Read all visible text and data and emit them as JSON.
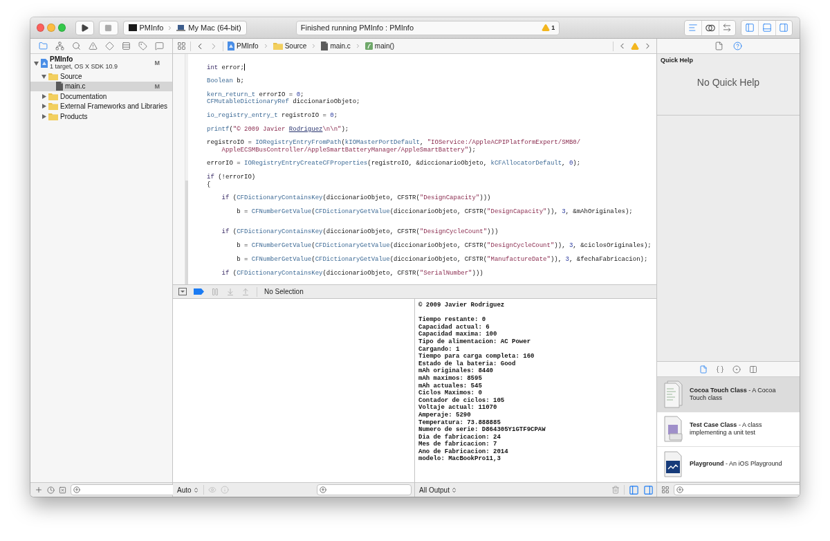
{
  "toolbar": {
    "scheme": {
      "target": "PMInfo",
      "destination": "My Mac (64-bit)"
    },
    "activity": {
      "status": "Finished running PMInfo : PMInfo",
      "warning_count": "1"
    },
    "editor_modes": [
      {
        "selected": true
      },
      {
        "selected": false
      },
      {
        "selected": false
      }
    ],
    "panel_toggles": [
      {
        "on": true
      },
      {
        "on": true
      },
      {
        "on": true
      }
    ]
  },
  "navigator": {
    "tabs": [
      {
        "selected": true
      },
      {
        "selected": false
      },
      {
        "selected": false
      },
      {
        "selected": false
      },
      {
        "selected": false
      },
      {
        "selected": false
      },
      {
        "selected": false
      },
      {
        "selected": false
      }
    ],
    "tree": [
      {
        "name": "PMInfo",
        "subtitle": "1 target, OS X SDK 10.9",
        "badge": "M",
        "kind": "project",
        "expanded": true,
        "selected": false,
        "children": [
          {
            "name": "Source",
            "kind": "folder",
            "expanded": true,
            "selected": false,
            "children": [
              {
                "name": "main.c",
                "kind": "file",
                "badge": "M",
                "selected": true
              }
            ]
          },
          {
            "name": "Documentation",
            "kind": "folder",
            "expanded": false,
            "selected": false
          },
          {
            "name": "External Frameworks and Libraries",
            "kind": "folder",
            "expanded": false,
            "selected": false
          },
          {
            "name": "Products",
            "kind": "folder",
            "expanded": false,
            "selected": false
          }
        ]
      }
    ]
  },
  "jump_bar": {
    "path": [
      {
        "label": "PMInfo",
        "kind": "project"
      },
      {
        "label": "Source",
        "kind": "folder"
      },
      {
        "label": "main.c",
        "kind": "file"
      },
      {
        "label": "main()",
        "kind": "function"
      }
    ]
  },
  "editor": {
    "lines": [
      {
        "kind": "code",
        "caret": true,
        "tokens": [
          {
            "text": "int",
            "kind": "keyword"
          },
          {
            "text": " error;",
            "kind": "plain"
          }
        ]
      },
      {
        "kind": "blank"
      },
      {
        "kind": "code",
        "tokens": [
          {
            "text": "Boolean",
            "kind": "symbol"
          },
          {
            "text": " b;",
            "kind": "plain"
          }
        ]
      },
      {
        "kind": "blank"
      },
      {
        "kind": "code",
        "tokens": [
          {
            "text": "kern_return_t",
            "kind": "symbol"
          },
          {
            "text": " errorIO = ",
            "kind": "plain"
          },
          {
            "text": "0",
            "kind": "number"
          },
          {
            "text": ";",
            "kind": "plain"
          }
        ]
      },
      {
        "kind": "code",
        "tokens": [
          {
            "text": "CFMutableDictionaryRef",
            "kind": "symbol"
          },
          {
            "text": " diccionarioObjeto;",
            "kind": "plain"
          }
        ]
      },
      {
        "kind": "blank"
      },
      {
        "kind": "code",
        "tokens": [
          {
            "text": "io_registry_entry_t",
            "kind": "symbol"
          },
          {
            "text": " registroIO = ",
            "kind": "plain"
          },
          {
            "text": "0",
            "kind": "number"
          },
          {
            "text": ";",
            "kind": "plain"
          }
        ]
      },
      {
        "kind": "blank"
      },
      {
        "kind": "code",
        "tokens": [
          {
            "text": "printf",
            "kind": "symbol"
          },
          {
            "text": "(",
            "kind": "plain"
          },
          {
            "text": "\"© 2009 Javier ",
            "kind": "string"
          },
          {
            "text": "Rodriguez",
            "kind": "link"
          },
          {
            "text": "\\n\\n\"",
            "kind": "string"
          },
          {
            "text": ");",
            "kind": "plain"
          }
        ]
      },
      {
        "kind": "blank"
      },
      {
        "kind": "code",
        "tokens": [
          {
            "text": "registroIO = ",
            "kind": "plain"
          },
          {
            "text": "IORegistryEntryFromPath",
            "kind": "symbol"
          },
          {
            "text": "(",
            "kind": "plain"
          },
          {
            "text": "kIOMasterPortDefault",
            "kind": "symbol"
          },
          {
            "text": ", ",
            "kind": "plain"
          },
          {
            "text": "\"IOService:/AppleACPIPlatformExpert/SMB0/",
            "kind": "string"
          }
        ]
      },
      {
        "kind": "code",
        "tokens": [
          {
            "text": "    AppleECSMBusController/AppleSmartBatteryManager/AppleSmartBattery\"",
            "kind": "string"
          },
          {
            "text": ");",
            "kind": "plain"
          }
        ]
      },
      {
        "kind": "blank"
      },
      {
        "kind": "code",
        "tokens": [
          {
            "text": "errorIO = ",
            "kind": "plain"
          },
          {
            "text": "IORegistryEntryCreateCFProperties",
            "kind": "symbol"
          },
          {
            "text": "(registroIO, &diccionarioObjeto, ",
            "kind": "plain"
          },
          {
            "text": "kCFAllocatorDefault",
            "kind": "symbol"
          },
          {
            "text": ", ",
            "kind": "plain"
          },
          {
            "text": "0",
            "kind": "number"
          },
          {
            "text": ");",
            "kind": "plain"
          }
        ]
      },
      {
        "kind": "blank"
      },
      {
        "kind": "code",
        "tokens": [
          {
            "text": "if",
            "kind": "keyword"
          },
          {
            "text": " (!errorIO)",
            "kind": "plain"
          }
        ]
      },
      {
        "kind": "code",
        "tokens": [
          {
            "text": "{",
            "kind": "plain"
          }
        ]
      },
      {
        "kind": "blank"
      },
      {
        "kind": "code",
        "tokens": [
          {
            "text": "    if",
            "kind": "keyword"
          },
          {
            "text": " (",
            "kind": "plain"
          },
          {
            "text": "CFDictionaryContainsKey",
            "kind": "symbol"
          },
          {
            "text": "(diccionarioObjeto, CFSTR(",
            "kind": "plain"
          },
          {
            "text": "\"DesignCapacity\"",
            "kind": "string"
          },
          {
            "text": ")))",
            "kind": "plain"
          }
        ]
      },
      {
        "kind": "blank"
      },
      {
        "kind": "code",
        "tokens": [
          {
            "text": "        b = ",
            "kind": "plain"
          },
          {
            "text": "CFNumberGetValue",
            "kind": "symbol"
          },
          {
            "text": "(",
            "kind": "plain"
          },
          {
            "text": "CFDictionaryGetValue",
            "kind": "symbol"
          },
          {
            "text": "(diccionarioObjeto, CFSTR(",
            "kind": "plain"
          },
          {
            "text": "\"DesignCapacity\"",
            "kind": "string"
          },
          {
            "text": ")), ",
            "kind": "plain"
          },
          {
            "text": "3",
            "kind": "number"
          },
          {
            "text": ", &mAhOriginales);",
            "kind": "plain"
          }
        ]
      },
      {
        "kind": "blank"
      },
      {
        "kind": "blank"
      },
      {
        "kind": "code",
        "tokens": [
          {
            "text": "    if",
            "kind": "keyword"
          },
          {
            "text": " (",
            "kind": "plain"
          },
          {
            "text": "CFDictionaryContainsKey",
            "kind": "symbol"
          },
          {
            "text": "(diccionarioObjeto, CFSTR(",
            "kind": "plain"
          },
          {
            "text": "\"DesignCycleCount\"",
            "kind": "string"
          },
          {
            "text": ")))",
            "kind": "plain"
          }
        ]
      },
      {
        "kind": "blank"
      },
      {
        "kind": "code",
        "tokens": [
          {
            "text": "        b = ",
            "kind": "plain"
          },
          {
            "text": "CFNumberGetValue",
            "kind": "symbol"
          },
          {
            "text": "(",
            "kind": "plain"
          },
          {
            "text": "CFDictionaryGetValue",
            "kind": "symbol"
          },
          {
            "text": "(diccionarioObjeto, CFSTR(",
            "kind": "plain"
          },
          {
            "text": "\"DesignCycleCount\"",
            "kind": "string"
          },
          {
            "text": ")), ",
            "kind": "plain"
          },
          {
            "text": "3",
            "kind": "number"
          },
          {
            "text": ", &ciclosOriginales);",
            "kind": "plain"
          }
        ]
      },
      {
        "kind": "blank"
      },
      {
        "kind": "code",
        "tokens": [
          {
            "text": "        b = ",
            "kind": "plain"
          },
          {
            "text": "CFNumberGetValue",
            "kind": "symbol"
          },
          {
            "text": "(",
            "kind": "plain"
          },
          {
            "text": "CFDictionaryGetValue",
            "kind": "symbol"
          },
          {
            "text": "(diccionarioObjeto, CFSTR(",
            "kind": "plain"
          },
          {
            "text": "\"ManufactureDate\"",
            "kind": "string"
          },
          {
            "text": ")), ",
            "kind": "plain"
          },
          {
            "text": "3",
            "kind": "number"
          },
          {
            "text": ", &fechaFabricacion);",
            "kind": "plain"
          }
        ]
      },
      {
        "kind": "blank"
      },
      {
        "kind": "code",
        "tokens": [
          {
            "text": "    if",
            "kind": "keyword"
          },
          {
            "text": " (",
            "kind": "plain"
          },
          {
            "text": "CFDictionaryContainsKey",
            "kind": "symbol"
          },
          {
            "text": "(diccionarioObjeto, CFSTR(",
            "kind": "plain"
          },
          {
            "text": "\"SerialNumber\"",
            "kind": "string"
          },
          {
            "text": ")))",
            "kind": "plain"
          }
        ]
      }
    ]
  },
  "debug_bar": {
    "breakpoints_active": true,
    "status": "No Selection"
  },
  "variables_view": {
    "scope": "Auto"
  },
  "console": {
    "output": "© 2009 Javier Rodriguez\n\nTiempo restante: 0\nCapacidad actual: 6\nCapacidad maxima: 100\nTipo de alimentacion: AC Power\nCargando: 1\nTiempo para carga completa: 160\nEstado de la bateria: Good\nmAh originales: 8440\nmAh maximos: 8595\nmAh actuales: 545\nCiclos Maximos: 0\nContador de ciclos: 105\nVoltaje actual: 11070\nAmperaje: 5290\nTemperatura: 73.888885\nNumero de serie: D864305Y1GTF9CPAW\nDia de fabricacion: 24\nMes de fabricacion: 7\nAno de Fabricacion: 2014\nmodelo: MacBookPro11,3",
    "filter": "All Output",
    "panes": [
      {
        "on": true
      },
      {
        "on": true
      }
    ]
  },
  "utilities": {
    "tabs": [
      {
        "selected": false
      },
      {
        "selected": true
      }
    ],
    "quick_help": {
      "title": "Quick Help",
      "message": "No Quick Help"
    },
    "library_tabs": [
      {
        "selected": true
      },
      {
        "selected": false
      },
      {
        "selected": false
      },
      {
        "selected": false
      }
    ],
    "templates": [
      {
        "description": "**Cocoa Touch Class** - A Cocoa Touch class",
        "selected": true
      },
      {
        "description": "**Test Case Class** - A class implementing a unit test",
        "selected": false
      },
      {
        "description": "**Playground** - An iOS Playground",
        "selected": false
      }
    ]
  }
}
